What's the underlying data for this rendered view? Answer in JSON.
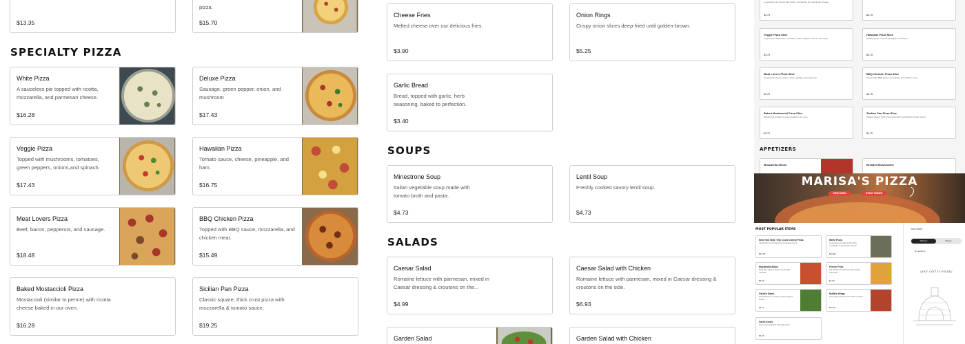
{
  "top_prices": {
    "left": "$13.35",
    "middle": "$15.70",
    "middle_desc": "pizza."
  },
  "specialty": {
    "title": "SPECIALTY PIZZA",
    "items": [
      {
        "name": "White Pizza",
        "desc": "A sauceless pie topped with ricotta, mozzarella, and parmesan cheese.",
        "price": "$16.28"
      },
      {
        "name": "Deluxe Pizza",
        "desc": "Sausage, green pepper, onion, and mushroom",
        "price": "$17.43"
      },
      {
        "name": "Veggie Pizza",
        "desc": "Topped with mushrooms, tomatoes, green peppers, onions,and spinach.",
        "price": "$17.43"
      },
      {
        "name": "Hawaiian Pizza",
        "desc": "Tomato sauce, cheese, pineapple, and ham.",
        "price": "$16.75"
      },
      {
        "name": "Meat Lovers Pizza",
        "desc": "Beef, bacon, pepperoni, and sausage.",
        "price": "$18.48"
      },
      {
        "name": "BBQ Chicken Pizza",
        "desc": "Topped with BBQ sauce, mozzarella, and chicken meat.",
        "price": "$15.49"
      },
      {
        "name": "Baked Mostaccioli Pizza",
        "desc": "Mostaccioli (similar to penne) with ricotta cheese baked in our oven.",
        "price": "$16.28"
      },
      {
        "name": "Sicilian Pan Pizza",
        "desc": "Classic square, thick crust pizza with mozzarella & tomato sauce.",
        "price": "$19.25"
      }
    ]
  },
  "appetizers": [
    {
      "name": "Cheese Fries",
      "desc": "Melted cheese over our delicious fries.",
      "price": "$3.90"
    },
    {
      "name": "Onion Rings",
      "desc": "Crispy onion slices deep-fried until golden-brown.",
      "price": "$5.25"
    },
    {
      "name": "Garlic Bread",
      "desc": "Bread, topped with garlic, herb seasoning, baked to perfection.",
      "price": "$3.40"
    }
  ],
  "soups": {
    "title": "SOUPS",
    "items": [
      {
        "name": "Minestrone Soup",
        "desc": "Italian vegetable soup made with tomato broth and pasta.",
        "price": "$4.73"
      },
      {
        "name": "Lentil Soup",
        "desc": "Freshly cooked savory lentil soup.",
        "price": "$4.73"
      }
    ]
  },
  "salads": {
    "title": "SALADS",
    "items": [
      {
        "name": "Caesar Salad",
        "desc": "Romaine lettuce with parmesan, mixed in Caesar dressing & croutons on the...",
        "price": "$4.99"
      },
      {
        "name": "Caesar Salad with Chicken",
        "desc": "Romaine lettuce with parmesan, mixed in Caesar dressing & croutons on the side.",
        "price": "$6.93"
      },
      {
        "name": "Garden Salad"
      },
      {
        "name": "Garden Salad with Chicken"
      }
    ]
  },
  "preview": {
    "slices": [
      {
        "name": "",
        "desc": "A sauceless pie topped with ricotta, mozzarella, and parmesan cheese.",
        "price": "$3.75"
      },
      {
        "name": "",
        "desc": "",
        "price": "$3.75"
      },
      {
        "name": "Veggie Pizza Slice",
        "desc": "Topped with mushrooms, tomatoes, green peppers, onions, and olives.",
        "price": "$3.75"
      },
      {
        "name": "Hawaiian Pizza Slice",
        "desc": "Tomato sauce, cheese, pineapple, and bacon.",
        "price": "$3.75"
      },
      {
        "name": "Meat Lovers Pizza Slice",
        "desc": "Topped with cheese, bacon, beef, sausage and pepperoni.",
        "price": "$3.75"
      },
      {
        "name": "BBQ Chicken Pizza Slice",
        "desc": "Topped with BBQ sauce, mozzarella, and chicken meat.",
        "price": "$3.75"
      },
      {
        "name": "Baked Mostaccioli Pizza Slice",
        "desc": "Mostaccioli (similar to penne) baked in our oven.",
        "price": "$3.75"
      },
      {
        "name": "Sicilian Pan Pizza Slice",
        "desc": "Classic square, thick crust pizza with mozzarella & tomato sauce.",
        "price": "$3.75"
      }
    ],
    "appetizers_title": "APPETIZERS",
    "app_items": [
      "Mozzarella Sticks",
      "Breaded Mushrooms"
    ],
    "hero_title": "MARISA'S PIZZA",
    "view_menu": "VIEW MENU",
    "start_order": "START ORDER",
    "popular_title": "MOST POPULAR ITEMS",
    "popular": [
      {
        "name": "New York Style Thin Crust Cheese Pizza",
        "desc": "Classic thin crust pizza with our signature sauce.",
        "price": "$13.35"
      },
      {
        "name": "White Pizza",
        "desc": "A sauceless pie topped with ricotta, mozzarella, and parmesan cheese.",
        "price": "$16.28"
      },
      {
        "name": "Mozzarella Sticks",
        "desc": "Deep fried sticks of cheese served with marinara.",
        "price": "$6.30"
      },
      {
        "name": "French Fries",
        "desc": "Our delicious French fries with a crispy outer layer.",
        "price": "$2.90"
      },
      {
        "name": "Garden Salad",
        "desc": "Romaine lettuce, tomatoes, green peppers, onions.",
        "price": "$4.47"
      },
      {
        "name": "Buffalo Wings",
        "desc": "Fried wings tossed in your choice of sauce.",
        "price": "$10.46"
      },
      {
        "name": "Garlic Knots",
        "desc": "Knots of bread glazed with garlic butter.",
        "price": "$2.40"
      }
    ],
    "order_title": "Your Order",
    "delivery": "Delivery",
    "pickup": "Pickup",
    "no_address": "No address",
    "empty_cart": "your cart is empty"
  }
}
